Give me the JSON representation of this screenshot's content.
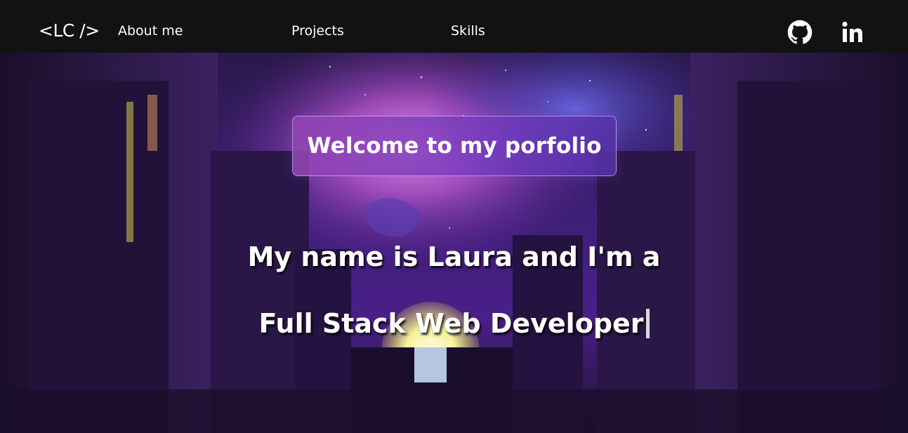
{
  "nav": {
    "logo": "<LC />",
    "links": [
      "About me",
      "Projects",
      "Skills"
    ],
    "social": [
      {
        "icon": "github-icon"
      },
      {
        "icon": "linkedin-icon",
        "glyph": "in"
      }
    ]
  },
  "hero": {
    "welcome": "Welcome to my porfolio",
    "line1": "My name is Laura and I'm a",
    "line2": "Full Stack Web Developer"
  },
  "colors": {
    "navbar": "#121212",
    "text": "#ffffff",
    "welcome_box": "#8a45b8",
    "background_purple": "#6a2aa0"
  }
}
